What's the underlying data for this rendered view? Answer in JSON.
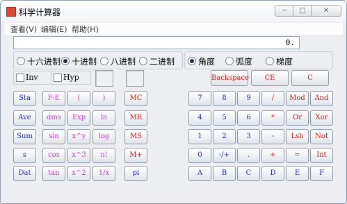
{
  "window": {
    "title": "科学计算器",
    "min_label": "─",
    "max_label": "□",
    "close_label": "✕"
  },
  "menu": {
    "view": "查看(V)",
    "edit": "编辑(E)",
    "help": "帮助(H)"
  },
  "display": {
    "value": "0."
  },
  "bases": [
    "十六进制",
    "十进制",
    "八进制",
    "二进制"
  ],
  "angles": [
    "角度",
    "弧度",
    "梯度"
  ],
  "checks": [
    "Inv",
    "Hyp"
  ],
  "top_buttons": [
    "Backspace",
    "CE",
    "C"
  ],
  "stat_buttons": [
    "Sta",
    "Ave",
    "Sum",
    "s",
    "Dat"
  ],
  "func_col1": [
    "F-E",
    "dms",
    "sin",
    "cos",
    "tan"
  ],
  "func_col2": [
    "(",
    "Exp",
    "x^y",
    "x^3",
    "x^2"
  ],
  "func_col3": [
    ")",
    "ln",
    "log",
    "n!",
    "1/x"
  ],
  "memory_buttons": [
    "MC",
    "MR",
    "MS",
    "M+",
    "pi"
  ],
  "keypad": [
    [
      "7",
      "8",
      "9",
      "/",
      "Mod",
      "And"
    ],
    [
      "4",
      "5",
      "6",
      "*",
      "Or",
      "Xor"
    ],
    [
      "1",
      "2",
      "3",
      "-",
      "Lsh",
      "Not"
    ],
    [
      "0",
      "-/+",
      ".",
      "+",
      "=",
      "Int"
    ],
    [
      "A",
      "B",
      "C",
      "D",
      "E",
      "F"
    ]
  ],
  "colors": {
    "blue": "#1c29b5",
    "pink": "#c83ac8",
    "red": "#c41a1a"
  }
}
